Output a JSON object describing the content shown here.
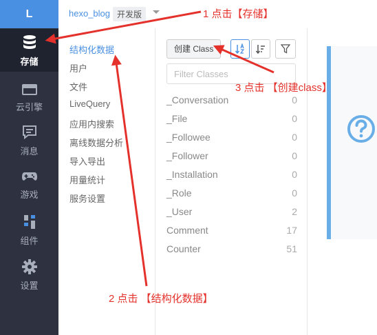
{
  "rail": {
    "logo": "L",
    "items": [
      {
        "label": "存储",
        "icon": "database-icon",
        "active": true
      },
      {
        "label": "云引擎",
        "icon": "server-icon"
      },
      {
        "label": "消息",
        "icon": "message-icon"
      },
      {
        "label": "游戏",
        "icon": "gamepad-icon"
      },
      {
        "label": "组件",
        "icon": "component-icon"
      },
      {
        "label": "设置",
        "icon": "gear-icon"
      }
    ]
  },
  "topbar": {
    "app_name": "hexo_blog",
    "env": "开发版"
  },
  "subnav": {
    "items": [
      "结构化数据",
      "用户",
      "文件",
      "LiveQuery",
      "应用内搜索",
      "离线数据分析",
      "导入导出",
      "用量统计",
      "服务设置"
    ]
  },
  "classes": {
    "create_button": "创建 Class",
    "filter_placeholder": "Filter Classes",
    "rows": [
      {
        "name": "_Conversation",
        "count": "0"
      },
      {
        "name": "_File",
        "count": "0"
      },
      {
        "name": "_Followee",
        "count": "0"
      },
      {
        "name": "_Follower",
        "count": "0"
      },
      {
        "name": "_Installation",
        "count": "0"
      },
      {
        "name": "_Role",
        "count": "0"
      },
      {
        "name": "_User",
        "count": "2"
      },
      {
        "name": "Comment",
        "count": "17"
      },
      {
        "name": "Counter",
        "count": "51"
      }
    ]
  },
  "annotations": {
    "a1": "1 点击【存储】",
    "a2": "2 点击 【结构化数据】",
    "a3": "3 点击 【创建class】"
  },
  "colors": {
    "accent": "#4a90e2",
    "annotation": "#e4312b",
    "rail": "#2d3140"
  }
}
